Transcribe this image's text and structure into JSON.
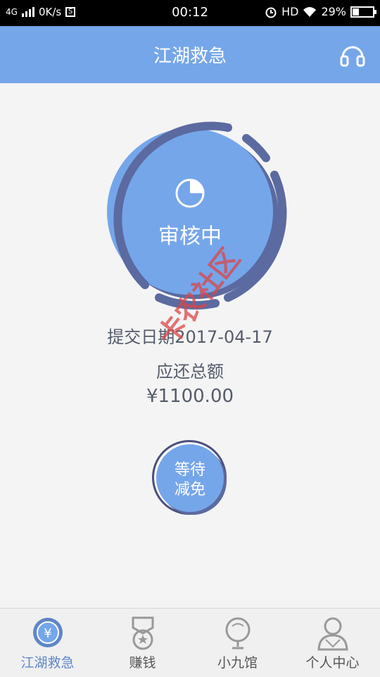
{
  "status_bar": {
    "network": "4G",
    "speed": "0K/s",
    "s_badge": "S",
    "time": "00:12",
    "hd": "HD",
    "battery": "29%"
  },
  "header": {
    "title": "江湖救急"
  },
  "review": {
    "status": "审核中"
  },
  "info": {
    "submit_date": "提交日期2017-04-17",
    "total_label": "应还总额",
    "total_amount": "¥1100.00"
  },
  "action": {
    "line1": "等待",
    "line2": "减免"
  },
  "watermark": "卡农社区",
  "tabs": [
    {
      "label": "江湖救急",
      "icon": "yuan-icon",
      "active": true
    },
    {
      "label": "赚钱",
      "icon": "medal-icon",
      "active": false
    },
    {
      "label": "小九馆",
      "icon": "pin-icon",
      "active": false
    },
    {
      "label": "个人中心",
      "icon": "user-icon",
      "active": false
    }
  ],
  "colors": {
    "accent": "#75a6ea",
    "ring_dark": "#5b6aa0",
    "text": "#555c6b"
  }
}
